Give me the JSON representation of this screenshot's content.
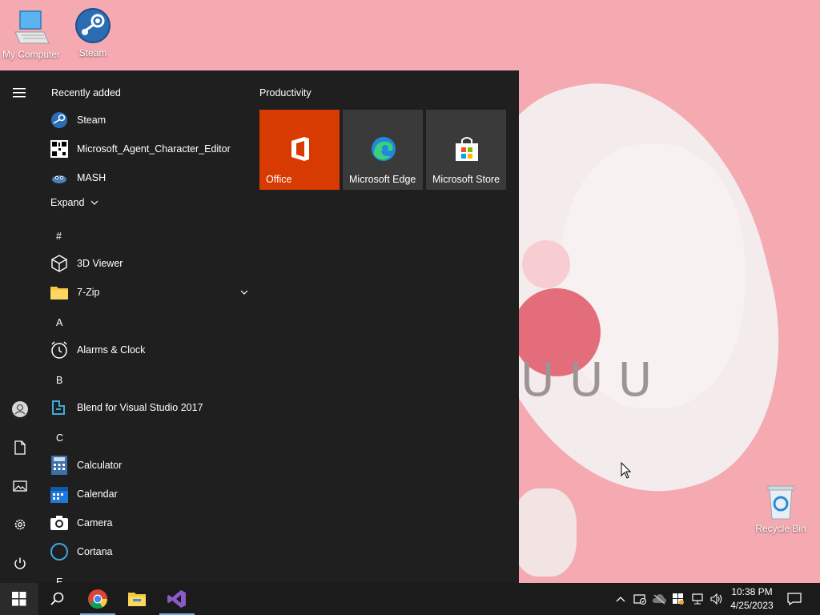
{
  "desktop": {
    "icons": [
      {
        "label": "My Computer"
      },
      {
        "label": "Steam"
      },
      {
        "label": "Recycle Bin"
      }
    ]
  },
  "start_menu": {
    "recently_added_title": "Recently added",
    "recent": [
      {
        "label": "Steam",
        "icon": "steam-icon"
      },
      {
        "label": "Microsoft_Agent_Character_Editor",
        "icon": "qr-app-icon"
      },
      {
        "label": "MASH",
        "icon": "mash-icon"
      }
    ],
    "expand_label": "Expand",
    "groups": [
      {
        "letter": "#",
        "items": [
          {
            "label": "3D Viewer",
            "icon": "cube-icon"
          },
          {
            "label": "7-Zip",
            "icon": "folder-icon"
          }
        ]
      },
      {
        "letter": "A",
        "items": [
          {
            "label": "Alarms & Clock",
            "icon": "clock-icon"
          }
        ]
      },
      {
        "letter": "B",
        "items": [
          {
            "label": "Blend for Visual Studio 2017",
            "icon": "blend-icon"
          }
        ]
      },
      {
        "letter": "C",
        "items": [
          {
            "label": "Calculator",
            "icon": "calculator-icon"
          },
          {
            "label": "Calendar",
            "icon": "calendar-icon"
          },
          {
            "label": "Camera",
            "icon": "camera-icon"
          },
          {
            "label": "Cortana",
            "icon": "cortana-icon"
          }
        ]
      },
      {
        "letter": "E",
        "items": []
      }
    ],
    "tiles_group_title": "Productivity",
    "tiles": [
      {
        "label": "Office",
        "color": "#d83b01"
      },
      {
        "label": "Microsoft Edge",
        "color": "#3a3a3a"
      },
      {
        "label": "Microsoft Store",
        "color": "#3a3a3a"
      }
    ]
  },
  "taskbar": {
    "clock": {
      "time": "10:38 PM",
      "date": "4/25/2023"
    }
  },
  "colors": {
    "wallpaper": "#f5a9b0",
    "start_bg": "#1f1f1f",
    "taskbar_bg": "#1b1b1b",
    "office_tile": "#d83b01"
  }
}
